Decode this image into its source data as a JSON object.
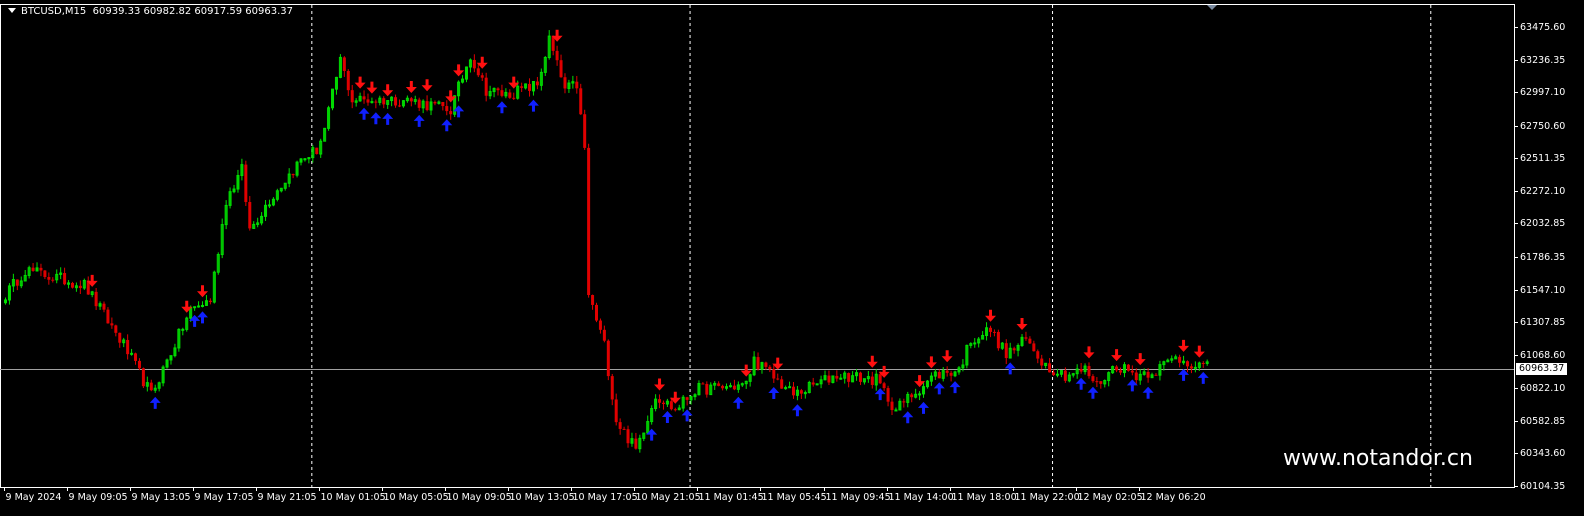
{
  "header": {
    "symbol": "BTCUSD,M15",
    "ohlc": "60939.33 60982.82 60917.59 60963.37"
  },
  "watermark": "www.notandor.cn",
  "colors": {
    "bull": "#00e000",
    "bear": "#e00000",
    "down_arrow": "#ff1010",
    "up_arrow": "#1020ff",
    "price_line": "#a0a0a0"
  },
  "chart_data": {
    "type": "candlestick",
    "title": "BTCUSD,M15",
    "ylim": [
      60104.35,
      63475.6
    ],
    "yticks": [
      "63475.60",
      "63236.35",
      "62997.10",
      "62750.60",
      "62511.35",
      "62272.10",
      "62032.85",
      "61786.35",
      "61547.10",
      "61307.85",
      "61068.60",
      "60822.10",
      "60582.85",
      "60343.60",
      "60104.35"
    ],
    "ytick_values": [
      63475.6,
      63236.35,
      62997.1,
      62750.6,
      62511.35,
      62272.1,
      62032.85,
      61786.35,
      61547.1,
      61307.85,
      61068.6,
      60822.1,
      60582.85,
      60343.6,
      60104.35
    ],
    "current_price": "60963.37",
    "current_price_value": 60963.37,
    "xticks": [
      "9 May 2024",
      "9 May 09:05",
      "9 May 13:05",
      "9 May 17:05",
      "9 May 21:05",
      "10 May 01:05",
      "10 May 05:05",
      "10 May 09:05",
      "10 May 13:05",
      "10 May 17:05",
      "10 May 21:05",
      "11 May 01:45",
      "11 May 05:45",
      "11 May 09:45",
      "11 May 14:00",
      "11 May 18:00",
      "11 May 22:00",
      "12 May 02:05",
      "12 May 06:20"
    ],
    "bars_per_tick": 16,
    "total_bars": 306,
    "day_separator_bars": [
      78,
      174,
      266,
      362
    ],
    "price_path": [
      [
        0,
        61507
      ],
      [
        5,
        61691
      ],
      [
        20,
        61581
      ],
      [
        30,
        61140
      ],
      [
        37,
        60773
      ],
      [
        47,
        61397
      ],
      [
        52,
        61471
      ],
      [
        56,
        62205
      ],
      [
        60,
        62425
      ],
      [
        62,
        61985
      ],
      [
        67,
        62205
      ],
      [
        75,
        62499
      ],
      [
        79,
        62572
      ],
      [
        81,
        62719
      ],
      [
        85,
        63233
      ],
      [
        88,
        62940
      ],
      [
        102,
        62940
      ],
      [
        113,
        62866
      ],
      [
        118,
        63270
      ],
      [
        122,
        63013
      ],
      [
        127,
        62977
      ],
      [
        135,
        63050
      ],
      [
        138,
        63380
      ],
      [
        142,
        63013
      ],
      [
        145,
        63050
      ],
      [
        147,
        62572
      ],
      [
        148,
        61507
      ],
      [
        152,
        61140
      ],
      [
        155,
        60589
      ],
      [
        160,
        60369
      ],
      [
        165,
        60773
      ],
      [
        170,
        60663
      ],
      [
        175,
        60810
      ],
      [
        188,
        60846
      ],
      [
        190,
        61030
      ],
      [
        200,
        60773
      ],
      [
        211,
        60920
      ],
      [
        221,
        60883
      ],
      [
        226,
        60663
      ],
      [
        230,
        60773
      ],
      [
        236,
        60920
      ],
      [
        242,
        60956
      ],
      [
        245,
        61177
      ],
      [
        250,
        61250
      ],
      [
        254,
        61067
      ],
      [
        259,
        61177
      ],
      [
        264,
        60993
      ],
      [
        269,
        60920
      ],
      [
        274,
        60956
      ],
      [
        277,
        60846
      ],
      [
        282,
        60993
      ],
      [
        287,
        60920
      ],
      [
        292,
        60956
      ],
      [
        297,
        61045
      ],
      [
        306,
        60963
      ]
    ],
    "sell_signal_bars": [
      22,
      46,
      50,
      90,
      93,
      97,
      103,
      107,
      113,
      115,
      121,
      129,
      140,
      166,
      170,
      188,
      196,
      220,
      223,
      232,
      235,
      239,
      250,
      258,
      275,
      282,
      288,
      299,
      303
    ],
    "buy_signal_bars": [
      38,
      48,
      50,
      91,
      94,
      97,
      105,
      112,
      115,
      126,
      134,
      164,
      168,
      173,
      186,
      195,
      201,
      222,
      229,
      233,
      237,
      241,
      255,
      273,
      276,
      286,
      290,
      299,
      304
    ]
  }
}
